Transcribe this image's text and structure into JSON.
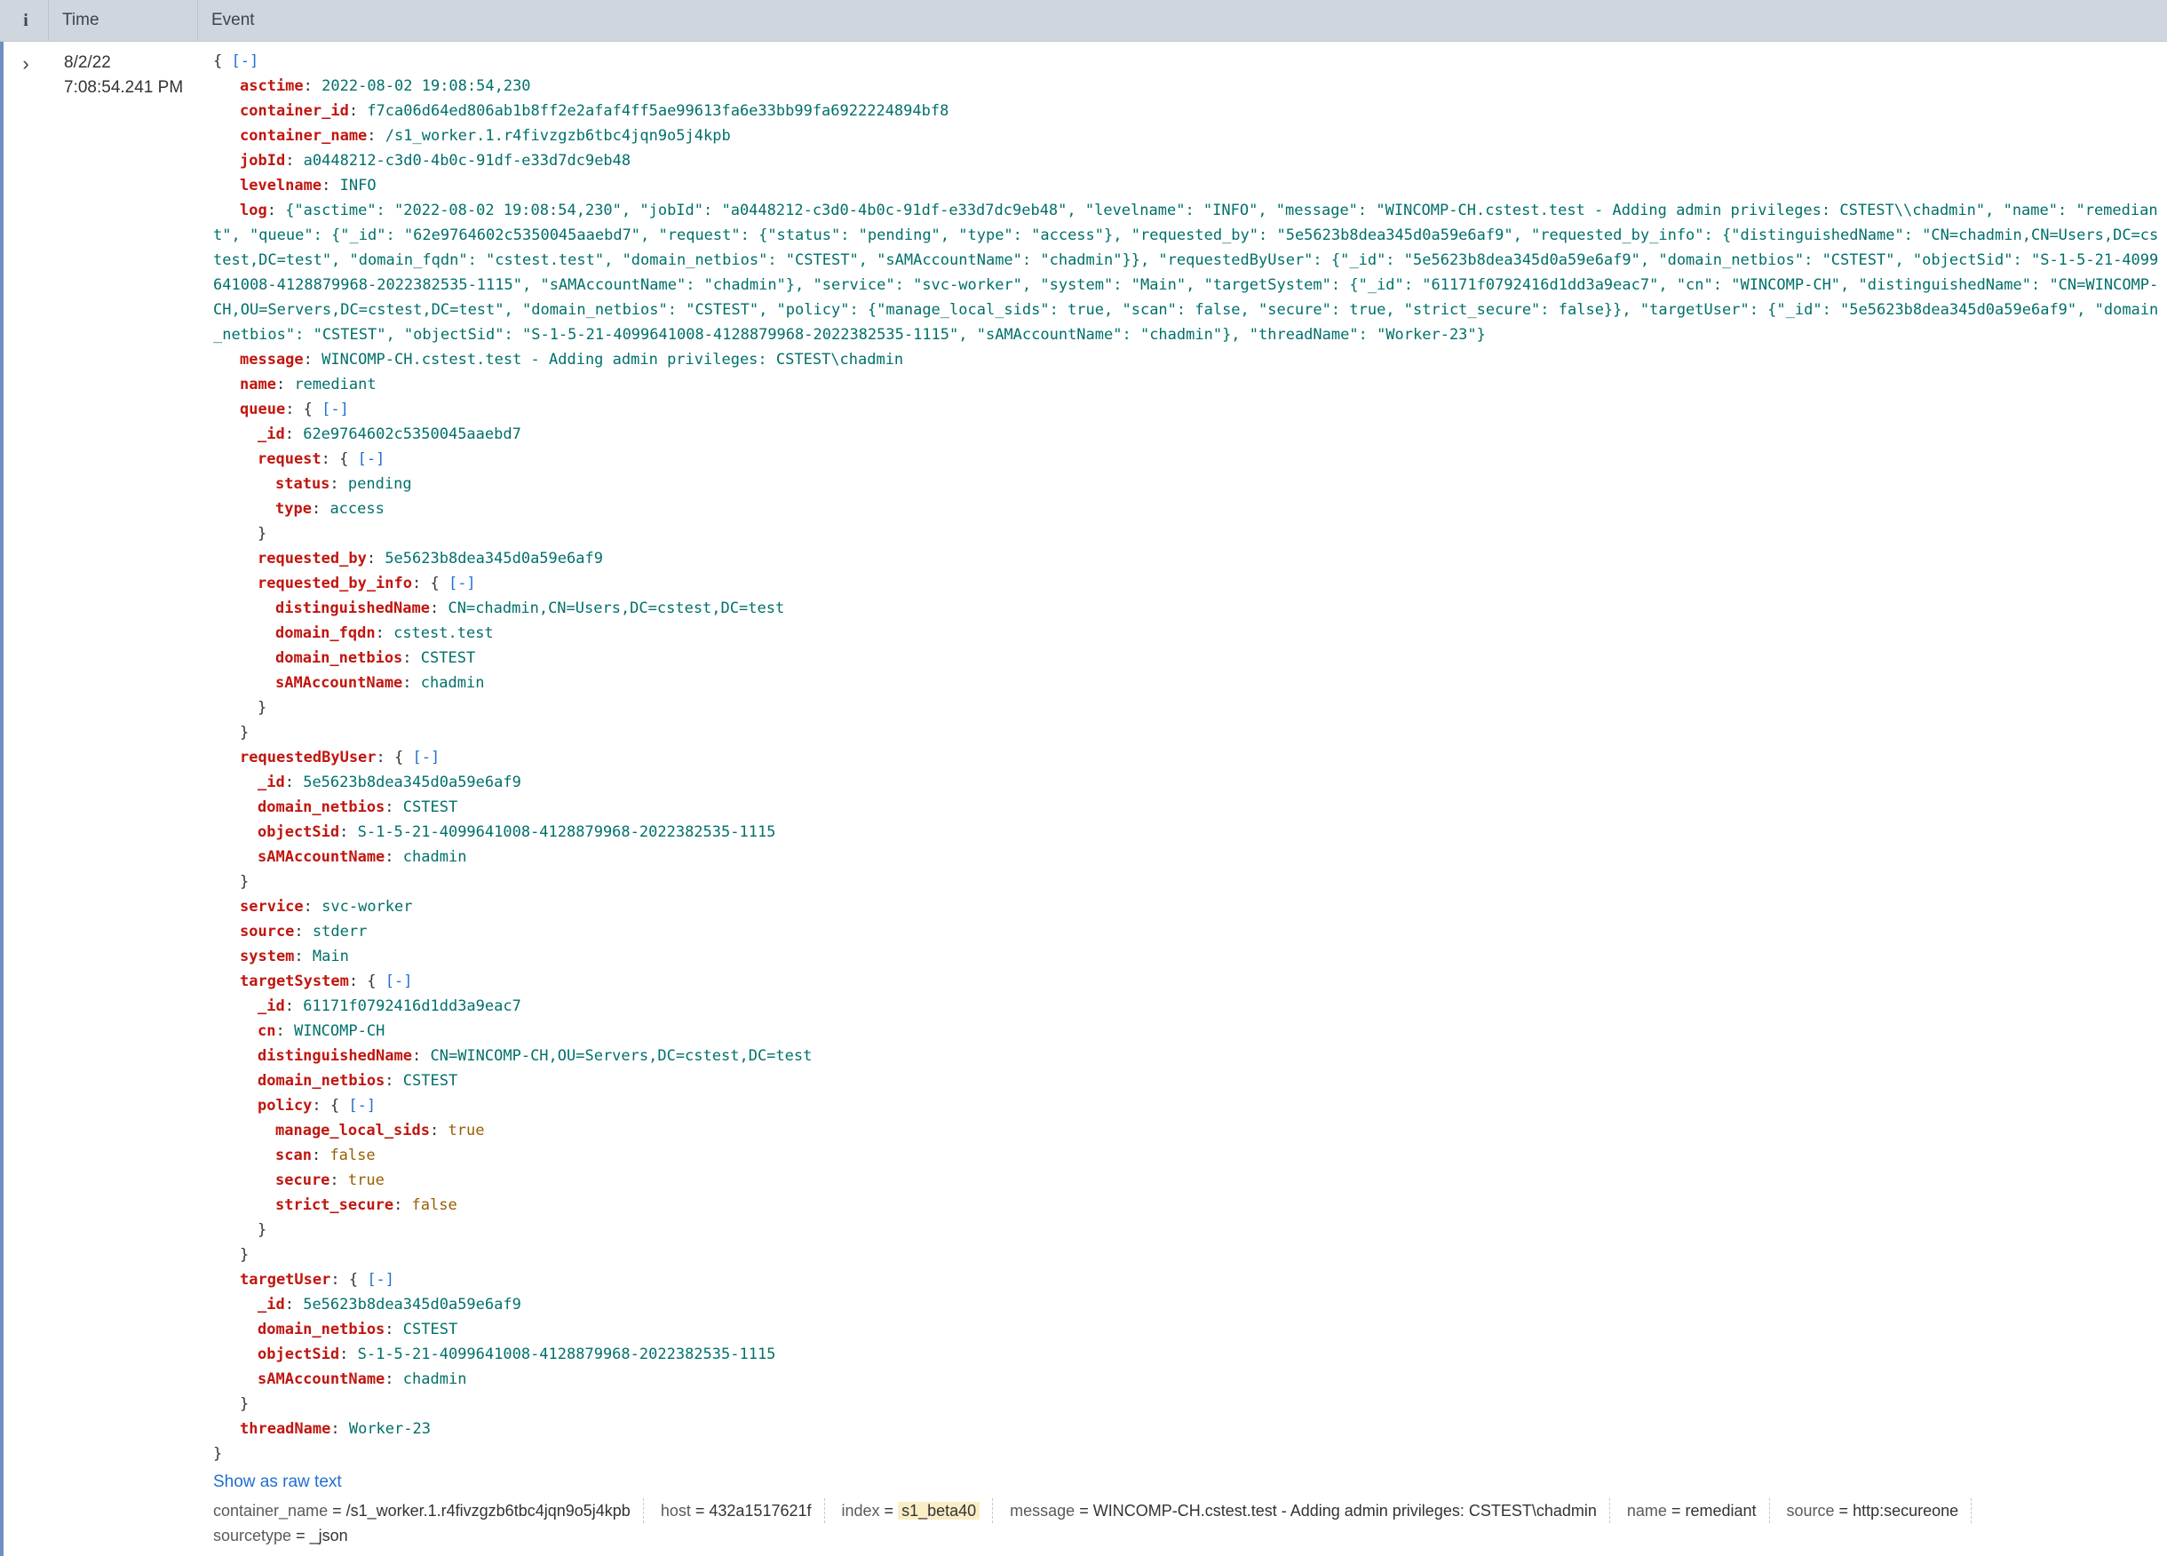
{
  "header": {
    "info": "i",
    "time": "Time",
    "event": "Event"
  },
  "event": {
    "date": "8/2/22",
    "time": "7:08:54.241 PM",
    "toggle": "[-]",
    "asctime": "2022-08-02 19:08:54,230",
    "container_id": "f7ca06d64ed806ab1b8ff2e2afaf4ff5ae99613fa6e33bb99fa6922224894bf8",
    "container_name": "/s1_worker.1.r4fivzgzb6tbc4jqn9o5j4kpb",
    "jobId": "a0448212-c3d0-4b0c-91df-e33d7dc9eb48",
    "levelname": "INFO",
    "log": "{\"asctime\": \"2022-08-02 19:08:54,230\", \"jobId\": \"a0448212-c3d0-4b0c-91df-e33d7dc9eb48\", \"levelname\": \"INFO\", \"message\": \"WINCOMP-CH.cstest.test - Adding admin privileges: CSTEST\\\\chadmin\", \"name\": \"remediant\", \"queue\": {\"_id\": \"62e9764602c5350045aaebd7\", \"request\": {\"status\": \"pending\", \"type\": \"access\"}, \"requested_by\": \"5e5623b8dea345d0a59e6af9\", \"requested_by_info\": {\"distinguishedName\": \"CN=chadmin,CN=Users,DC=cstest,DC=test\", \"domain_fqdn\": \"cstest.test\", \"domain_netbios\": \"CSTEST\", \"sAMAccountName\": \"chadmin\"}}, \"requestedByUser\": {\"_id\": \"5e5623b8dea345d0a59e6af9\", \"domain_netbios\": \"CSTEST\", \"objectSid\": \"S-1-5-21-4099641008-4128879968-2022382535-1115\", \"sAMAccountName\": \"chadmin\"}, \"service\": \"svc-worker\", \"system\": \"Main\", \"targetSystem\": {\"_id\": \"61171f0792416d1dd3a9eac7\", \"cn\": \"WINCOMP-CH\", \"distinguishedName\": \"CN=WINCOMP-CH,OU=Servers,DC=cstest,DC=test\", \"domain_netbios\": \"CSTEST\", \"policy\": {\"manage_local_sids\": true, \"scan\": false, \"secure\": true, \"strict_secure\": false}}, \"targetUser\": {\"_id\": \"5e5623b8dea345d0a59e6af9\", \"domain_netbios\": \"CSTEST\", \"objectSid\": \"S-1-5-21-4099641008-4128879968-2022382535-1115\", \"sAMAccountName\": \"chadmin\"}, \"threadName\": \"Worker-23\"}",
    "message": "WINCOMP-CH.cstest.test - Adding admin privileges: CSTEST\\chadmin",
    "name": "remediant",
    "queue": {
      "_id": "62e9764602c5350045aaebd7",
      "request": {
        "status": "pending",
        "type": "access"
      },
      "requested_by": "5e5623b8dea345d0a59e6af9",
      "requested_by_info": {
        "distinguishedName": "CN=chadmin,CN=Users,DC=cstest,DC=test",
        "domain_fqdn": "cstest.test",
        "domain_netbios": "CSTEST",
        "sAMAccountName": "chadmin"
      }
    },
    "requestedByUser": {
      "_id": "5e5623b8dea345d0a59e6af9",
      "domain_netbios": "CSTEST",
      "objectSid": "S-1-5-21-4099641008-4128879968-2022382535-1115",
      "sAMAccountName": "chadmin"
    },
    "service": "svc-worker",
    "source": "stderr",
    "system": "Main",
    "targetSystem": {
      "_id": "61171f0792416d1dd3a9eac7",
      "cn": "WINCOMP-CH",
      "distinguishedName": "CN=WINCOMP-CH,OU=Servers,DC=cstest,DC=test",
      "domain_netbios": "CSTEST",
      "policy": {
        "manage_local_sids": "true",
        "scan": "false",
        "secure": "true",
        "strict_secure": "false"
      }
    },
    "targetUser": {
      "_id": "5e5623b8dea345d0a59e6af9",
      "domain_netbios": "CSTEST",
      "objectSid": "S-1-5-21-4099641008-4128879968-2022382535-1115",
      "sAMAccountName": "chadmin"
    },
    "threadName": "Worker-23"
  },
  "actions": {
    "show_raw": "Show as raw text"
  },
  "fields": [
    {
      "key": "container_name",
      "value": "/s1_worker.1.r4fivzgzb6tbc4jqn9o5j4kpb"
    },
    {
      "key": "host",
      "value": "432a1517621f"
    },
    {
      "key": "index",
      "value": "s1_beta40"
    },
    {
      "key": "message",
      "value": "WINCOMP-CH.cstest.test - Adding admin privileges: CSTEST\\chadmin"
    },
    {
      "key": "name",
      "value": "remediant"
    },
    {
      "key": "source",
      "value": "http:secureone"
    },
    {
      "key": "sourcetype",
      "value": "_json"
    }
  ],
  "colors": {
    "key": "#c0160f",
    "string": "#00706a",
    "boolean": "#9a5d00",
    "link": "#1f6fd1",
    "header_bg": "#d0d6dd",
    "highlight": "#fbeec6"
  }
}
